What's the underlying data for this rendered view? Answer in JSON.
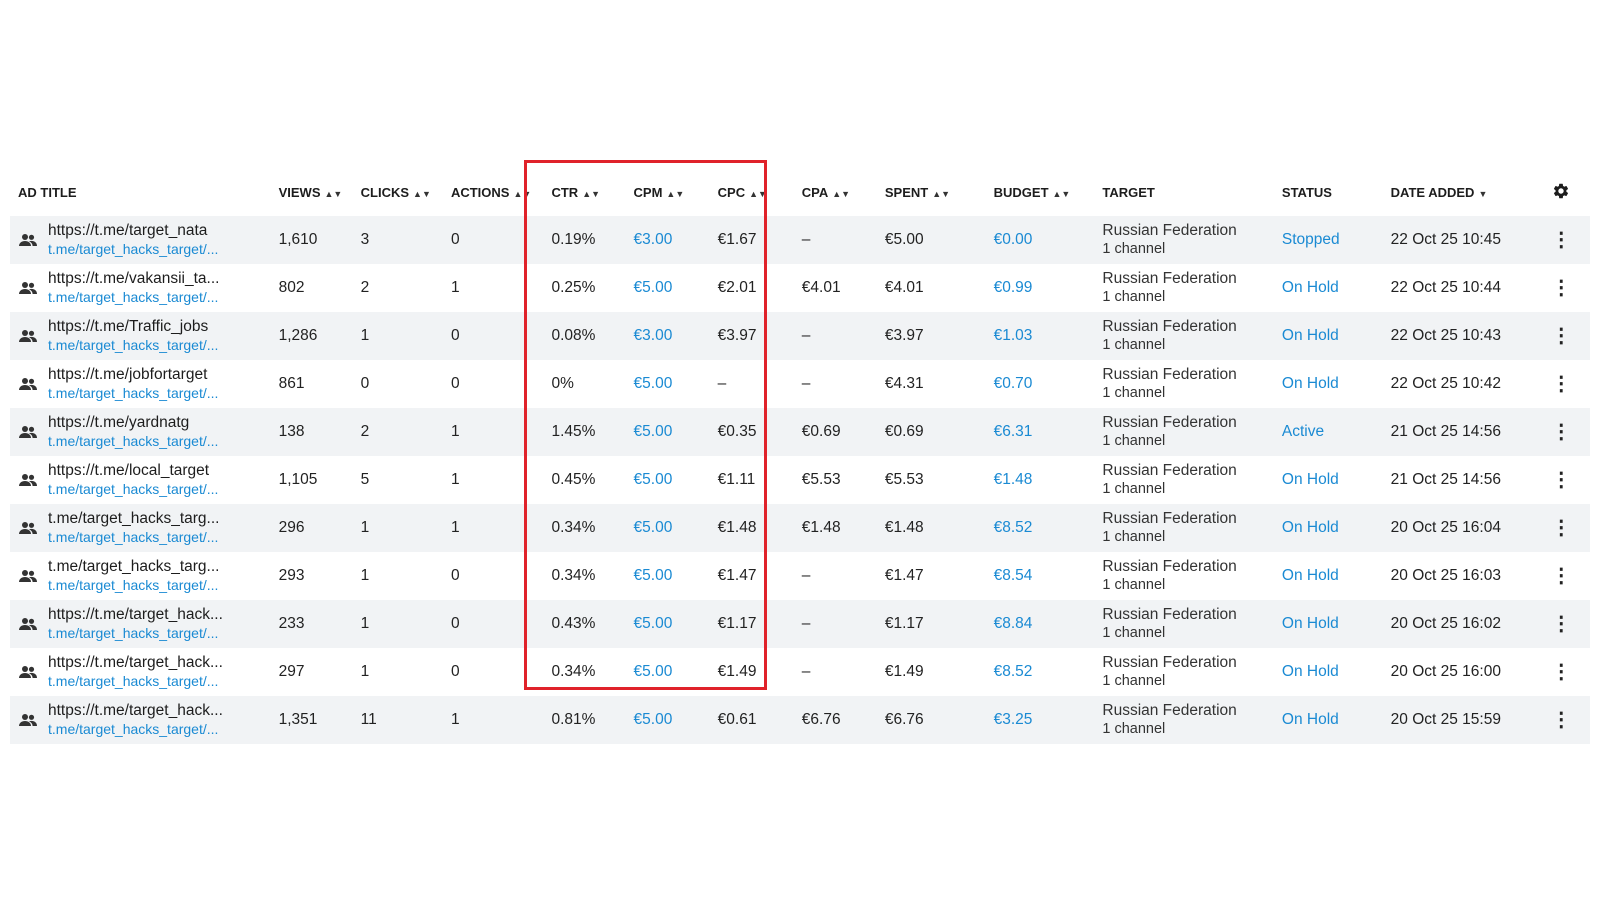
{
  "columns": {
    "ad_title": "AD TITLE",
    "views": "VIEWS",
    "clicks": "CLICKS",
    "actions": "ACTIONS",
    "ctr": "CTR",
    "cpm": "CPM",
    "cpc": "CPC",
    "cpa": "CPA",
    "spent": "SPENT",
    "budget": "BUDGET",
    "target": "TARGET",
    "status": "STATUS",
    "date_added": "DATE ADDED"
  },
  "icons": {
    "sort": "sort-icon",
    "sort_down": "sort-down-icon",
    "settings": "gear-icon",
    "row_type": "users-icon",
    "row_menu": "more-vertical-icon"
  },
  "colors": {
    "link": "#1a8ad3",
    "highlight": "#e0222a",
    "row_stripe": "#f1f3f5"
  },
  "rows": [
    {
      "title": "https://t.me/target_nata",
      "link": "t.me/target_hacks_target/...",
      "views": "1,610",
      "clicks": "3",
      "actions": "0",
      "ctr": "0.19%",
      "cpm": "€3.00",
      "cpc": "€1.67",
      "cpa": "–",
      "spent": "€5.00",
      "budget": "€0.00",
      "target": "Russian Federation",
      "channels": "1 channel",
      "status": "Stopped",
      "date": "22 Oct 25 10:45"
    },
    {
      "title": "https://t.me/vakansii_ta...",
      "link": "t.me/target_hacks_target/...",
      "views": "802",
      "clicks": "2",
      "actions": "1",
      "ctr": "0.25%",
      "cpm": "€5.00",
      "cpc": "€2.01",
      "cpa": "€4.01",
      "spent": "€4.01",
      "budget": "€0.99",
      "target": "Russian Federation",
      "channels": "1 channel",
      "status": "On Hold",
      "date": "22 Oct 25 10:44"
    },
    {
      "title": "https://t.me/Traffic_jobs",
      "link": "t.me/target_hacks_target/...",
      "views": "1,286",
      "clicks": "1",
      "actions": "0",
      "ctr": "0.08%",
      "cpm": "€3.00",
      "cpc": "€3.97",
      "cpa": "–",
      "spent": "€3.97",
      "budget": "€1.03",
      "target": "Russian Federation",
      "channels": "1 channel",
      "status": "On Hold",
      "date": "22 Oct 25 10:43"
    },
    {
      "title": "https://t.me/jobfortarget",
      "link": "t.me/target_hacks_target/...",
      "views": "861",
      "clicks": "0",
      "actions": "0",
      "ctr": "0%",
      "cpm": "€5.00",
      "cpc": "–",
      "cpa": "–",
      "spent": "€4.31",
      "budget": "€0.70",
      "target": "Russian Federation",
      "channels": "1 channel",
      "status": "On Hold",
      "date": "22 Oct 25 10:42"
    },
    {
      "title": "https://t.me/yardnatg",
      "link": "t.me/target_hacks_target/...",
      "views": "138",
      "clicks": "2",
      "actions": "1",
      "ctr": "1.45%",
      "cpm": "€5.00",
      "cpc": "€0.35",
      "cpa": "€0.69",
      "spent": "€0.69",
      "budget": "€6.31",
      "target": "Russian Federation",
      "channels": "1 channel",
      "status": "Active",
      "date": "21 Oct 25 14:56"
    },
    {
      "title": "https://t.me/local_target",
      "link": "t.me/target_hacks_target/...",
      "views": "1,105",
      "clicks": "5",
      "actions": "1",
      "ctr": "0.45%",
      "cpm": "€5.00",
      "cpc": "€1.11",
      "cpa": "€5.53",
      "spent": "€5.53",
      "budget": "€1.48",
      "target": "Russian Federation",
      "channels": "1 channel",
      "status": "On Hold",
      "date": "21 Oct 25 14:56"
    },
    {
      "title": "t.me/target_hacks_targ...",
      "link": "t.me/target_hacks_target/...",
      "views": "296",
      "clicks": "1",
      "actions": "1",
      "ctr": "0.34%",
      "cpm": "€5.00",
      "cpc": "€1.48",
      "cpa": "€1.48",
      "spent": "€1.48",
      "budget": "€8.52",
      "target": "Russian Federation",
      "channels": "1 channel",
      "status": "On Hold",
      "date": "20 Oct 25 16:04"
    },
    {
      "title": "t.me/target_hacks_targ...",
      "link": "t.me/target_hacks_target/...",
      "views": "293",
      "clicks": "1",
      "actions": "0",
      "ctr": "0.34%",
      "cpm": "€5.00",
      "cpc": "€1.47",
      "cpa": "–",
      "spent": "€1.47",
      "budget": "€8.54",
      "target": "Russian Federation",
      "channels": "1 channel",
      "status": "On Hold",
      "date": "20 Oct 25 16:03"
    },
    {
      "title": "https://t.me/target_hack...",
      "link": "t.me/target_hacks_target/...",
      "views": "233",
      "clicks": "1",
      "actions": "0",
      "ctr": "0.43%",
      "cpm": "€5.00",
      "cpc": "€1.17",
      "cpa": "–",
      "spent": "€1.17",
      "budget": "€8.84",
      "target": "Russian Federation",
      "channels": "1 channel",
      "status": "On Hold",
      "date": "20 Oct 25 16:02"
    },
    {
      "title": "https://t.me/target_hack...",
      "link": "t.me/target_hacks_target/...",
      "views": "297",
      "clicks": "1",
      "actions": "0",
      "ctr": "0.34%",
      "cpm": "€5.00",
      "cpc": "€1.49",
      "cpa": "–",
      "spent": "€1.49",
      "budget": "€8.52",
      "target": "Russian Federation",
      "channels": "1 channel",
      "status": "On Hold",
      "date": "20 Oct 25 16:00"
    },
    {
      "title": "https://t.me/target_hack...",
      "link": "t.me/target_hacks_target/...",
      "views": "1,351",
      "clicks": "11",
      "actions": "1",
      "ctr": "0.81%",
      "cpm": "€5.00",
      "cpc": "€0.61",
      "cpa": "€6.76",
      "spent": "€6.76",
      "budget": "€3.25",
      "target": "Russian Federation",
      "channels": "1 channel",
      "status": "On Hold",
      "date": "20 Oct 25 15:59"
    }
  ]
}
